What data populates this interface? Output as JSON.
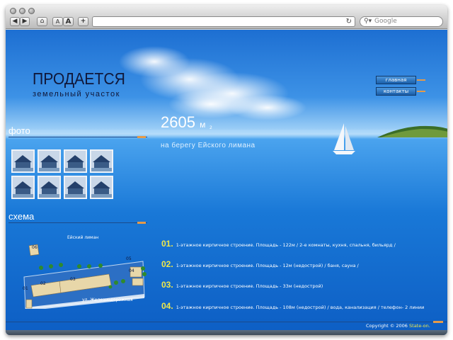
{
  "browser": {
    "back_label": "◀",
    "forward_label": "▶",
    "home_label": "⌂",
    "text_smaller_label": "A",
    "text_larger_label": "A",
    "add_bookmark_label": "+",
    "reload_icon": "reload-icon",
    "search_placeholder": "Google",
    "search_icon": "search-icon"
  },
  "page": {
    "logo_title": "ПРОДАЕТСЯ",
    "logo_subtitle": "земельный участок",
    "nav": [
      {
        "label": "главная"
      },
      {
        "label": "контакты"
      }
    ],
    "photo_section_title": "фото",
    "scheme_section_title": "схема",
    "area_value": "2605",
    "area_unit": "м",
    "area_unit_sup": "2",
    "area_caption": "на берегу Ейского лимана",
    "scheme": {
      "lake_label": "Ейский лиман",
      "street_label": "ул. Железнодорожная",
      "plots": [
        "01",
        "02",
        "03",
        "04",
        "05",
        "06"
      ]
    },
    "features": [
      {
        "num": "01.",
        "text": "1-этажное кирпичное строение. Площадь - 122м / 2-е комнаты, кухня, спальня, бильярд /"
      },
      {
        "num": "02.",
        "text": "1-этажное кирпичное строение. Площадь - 12м (недострой) / баня, сауна /"
      },
      {
        "num": "03.",
        "text": "1-этажное кирпичное строение. Площадь - 33м (недострой)"
      },
      {
        "num": "04.",
        "text": "1-этажное кирпичное строение. Площадь - 108м (недострой) / вода, канализация / телефон- 2 линии"
      }
    ],
    "copyright_prefix": "Copyright © 2006",
    "copyright_brand": "State-on."
  },
  "colors": {
    "accent_orange": "#e59a49",
    "accent_yellow": "#f0e84a",
    "sea_blue": "#1978d7",
    "logo_dark": "#10183a"
  }
}
